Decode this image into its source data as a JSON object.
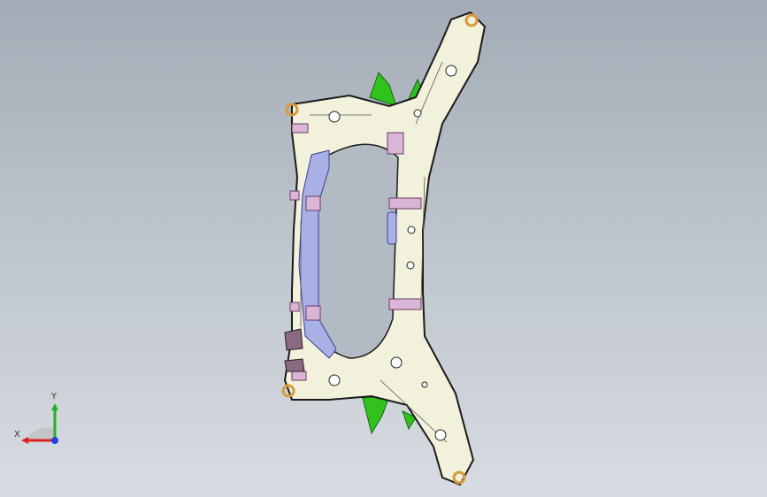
{
  "viewport": {
    "background_top": "#a3abb6",
    "background_bottom": "#d8dce2"
  },
  "model": {
    "part": "subframe",
    "body_color": "#f2f1dc",
    "inner_color": "#a9b0e6",
    "mount_color": "#d9b6d6",
    "accent_color": "#31c21e",
    "ring_color": "#d89a3c"
  },
  "triad": {
    "x_label": "X",
    "y_label": "Y",
    "x_color": "#e02020",
    "y_color": "#20b020",
    "z_color": "#2040e0"
  }
}
